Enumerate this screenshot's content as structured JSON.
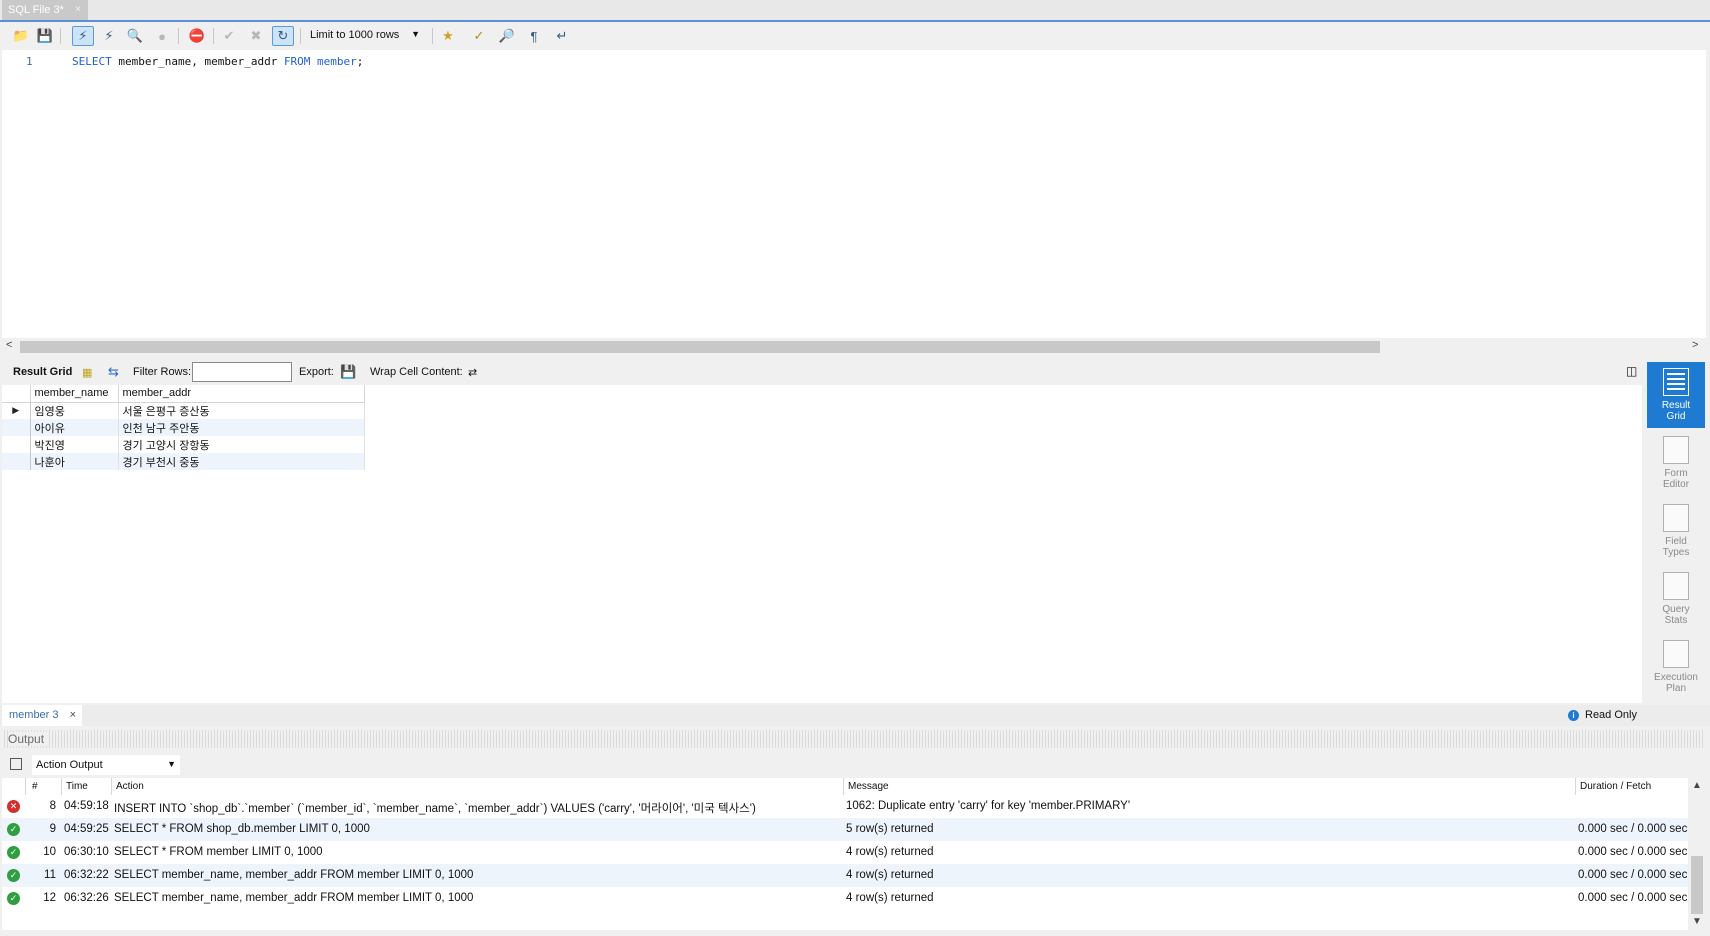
{
  "file_tab": {
    "label": "SQL File 3*",
    "close": "×"
  },
  "toolbar": {
    "limit_select": "Limit to 1000 rows",
    "icons": [
      "open-file-icon",
      "save-icon",
      "execute-icon",
      "execute-statement-icon",
      "explain-icon",
      "stop-icon",
      "toggle-continue-icon",
      "commit-icon",
      "rollback-icon",
      "autocommit-icon",
      "beautify-icon",
      "find-icon",
      "invisible-chars-icon",
      "wrap-icon"
    ]
  },
  "editor": {
    "line_number": "1",
    "code": {
      "kw1": "SELECT",
      "cols": " member_name, member_addr ",
      "kw2": "FROM",
      "table": " member",
      "end": ";"
    }
  },
  "result_toolbar": {
    "result_grid": "Result Grid",
    "filter_rows": "Filter Rows:",
    "filter_value": "",
    "export": "Export:",
    "wrap": "Wrap Cell Content:"
  },
  "grid": {
    "columns": [
      "member_name",
      "member_addr"
    ],
    "rows": [
      [
        "임영웅",
        "서울 은평구 증산동"
      ],
      [
        "아이유",
        "인천 남구 주안동"
      ],
      [
        "박진영",
        "경기 고양시 장항동"
      ],
      [
        "나훈아",
        "경기 부천시 중동"
      ]
    ]
  },
  "side_panel": [
    {
      "label1": "Result",
      "label2": "Grid",
      "active": true
    },
    {
      "label1": "Form",
      "label2": "Editor",
      "active": false
    },
    {
      "label1": "Field",
      "label2": "Types",
      "active": false
    },
    {
      "label1": "Query",
      "label2": "Stats",
      "active": false
    },
    {
      "label1": "Execution",
      "label2": "Plan",
      "active": false
    }
  ],
  "result_tab": {
    "label": "member 3",
    "close": "×",
    "read_only": "Read Only"
  },
  "output": {
    "title": "Output",
    "selector": "Action Output",
    "headers": {
      "num": "#",
      "time": "Time",
      "action": "Action",
      "message": "Message",
      "duration": "Duration / Fetch"
    },
    "rows": [
      {
        "status": "error",
        "num": "8",
        "time": "04:59:18",
        "action": "INSERT INTO `shop_db`.`member` (`member_id`, `member_name`, `member_addr`) VALUES ('carry', '머라이어', '미국 텍사스')",
        "message": "1062: Duplicate entry 'carry' for key 'member.PRIMARY'",
        "duration": ""
      },
      {
        "status": "ok",
        "num": "9",
        "time": "04:59:25",
        "action": "SELECT * FROM shop_db.member LIMIT 0, 1000",
        "message": "5 row(s) returned",
        "duration": "0.000 sec / 0.000 sec"
      },
      {
        "status": "ok",
        "num": "10",
        "time": "06:30:10",
        "action": "SELECT * FROM member LIMIT 0, 1000",
        "message": "4 row(s) returned",
        "duration": "0.000 sec / 0.000 sec"
      },
      {
        "status": "ok",
        "num": "11",
        "time": "06:32:22",
        "action": "SELECT member_name, member_addr FROM member LIMIT 0, 1000",
        "message": "4 row(s) returned",
        "duration": "0.000 sec / 0.000 sec"
      },
      {
        "status": "ok",
        "num": "12",
        "time": "06:32:26",
        "action": "SELECT member_name, member_addr FROM member LIMIT 0, 1000",
        "message": "4 row(s) returned",
        "duration": "0.000 sec / 0.000 sec"
      }
    ]
  }
}
